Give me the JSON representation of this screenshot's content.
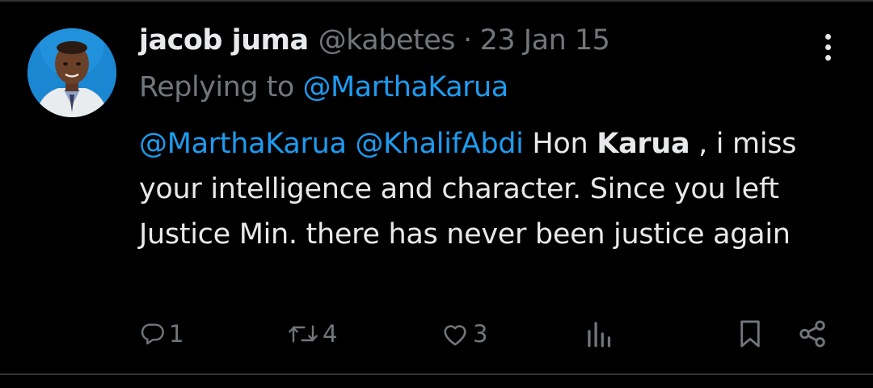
{
  "tweet": {
    "display_name": "jacob juma",
    "handle": "@kabetes",
    "separator": "·",
    "date": "23 Jan 15",
    "replying_prefix": "Replying to",
    "replying_to": "@MarthaKarua",
    "body": {
      "mention_1": "@MarthaKarua",
      "mention_2": "@KhalifAbdi",
      "text_before_bold": " Hon ",
      "bold_word": "Karua",
      "text_after_bold": " , i miss your intelligence and character. Since you left Justice Min. there has never been justice again"
    }
  },
  "actions": {
    "reply_count": "1",
    "retweet_count": "4",
    "like_count": "3",
    "icons": [
      "reply-icon",
      "retweet-icon",
      "like-icon",
      "views-icon",
      "bookmark-icon",
      "share-icon"
    ]
  },
  "colors": {
    "background": "#000000",
    "primary_text": "#e7e9ea",
    "secondary_text": "#71767b",
    "link": "#1d9bf0",
    "divider": "#2f3336"
  }
}
